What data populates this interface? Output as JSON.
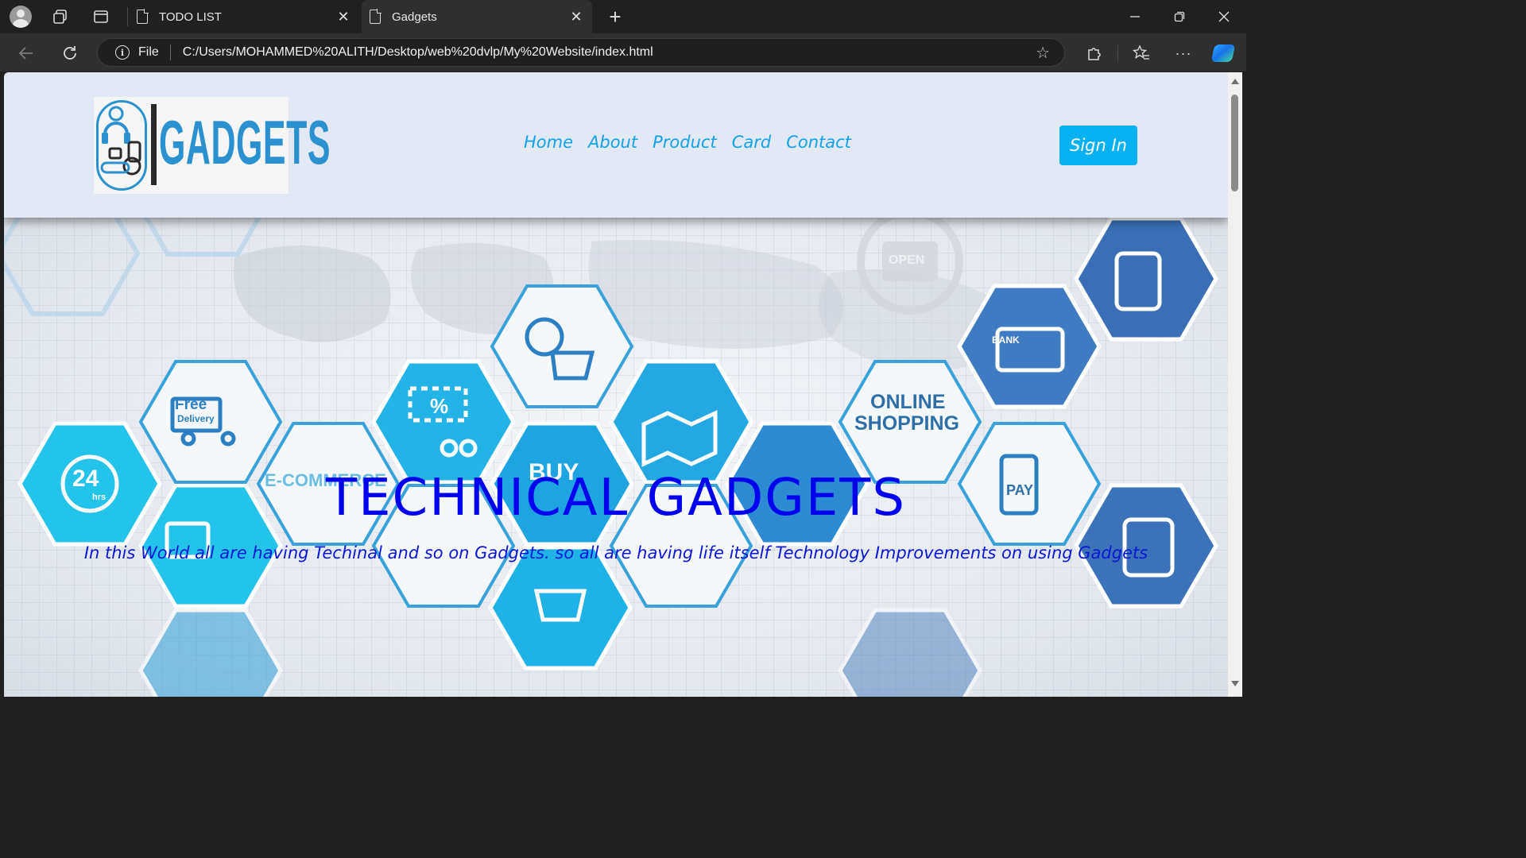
{
  "browser": {
    "tabs": [
      {
        "title": "TODO LIST"
      },
      {
        "title": "Gadgets"
      }
    ],
    "address": {
      "scheme_label": "File",
      "url": "C:/Users/MOHAMMED%20ALITH/Desktop/web%20dvlp/My%20Website/index.html"
    }
  },
  "site": {
    "logo_text": "GADGETS",
    "nav": [
      "Home",
      "About",
      "Product",
      "Card",
      "Contact"
    ],
    "signin_label": "Sign In",
    "hero": {
      "title": "TECHNICAL GADGETS",
      "subtitle": "In this World all are having Techinal and so on Gadgets. so all are having life itself Technology Improvements on using Gadgets",
      "hex_labels": {
        "free": "Free",
        "delivery": "Delivery",
        "ecommerce": "E-COMMERCE",
        "buy": "BUY",
        "online": "ONLINE",
        "shopping": "SHOPPING",
        "bank": "BANK",
        "pay": "PAY",
        "h24": "24",
        "hrs": "hrs",
        "percent": "%",
        "open": "OPEN"
      }
    }
  },
  "colors": {
    "accent": "#05b1f0",
    "nav_text": "#12a3e6",
    "hero_title": "#0000ee",
    "header_bg": "#e2e8f4"
  }
}
